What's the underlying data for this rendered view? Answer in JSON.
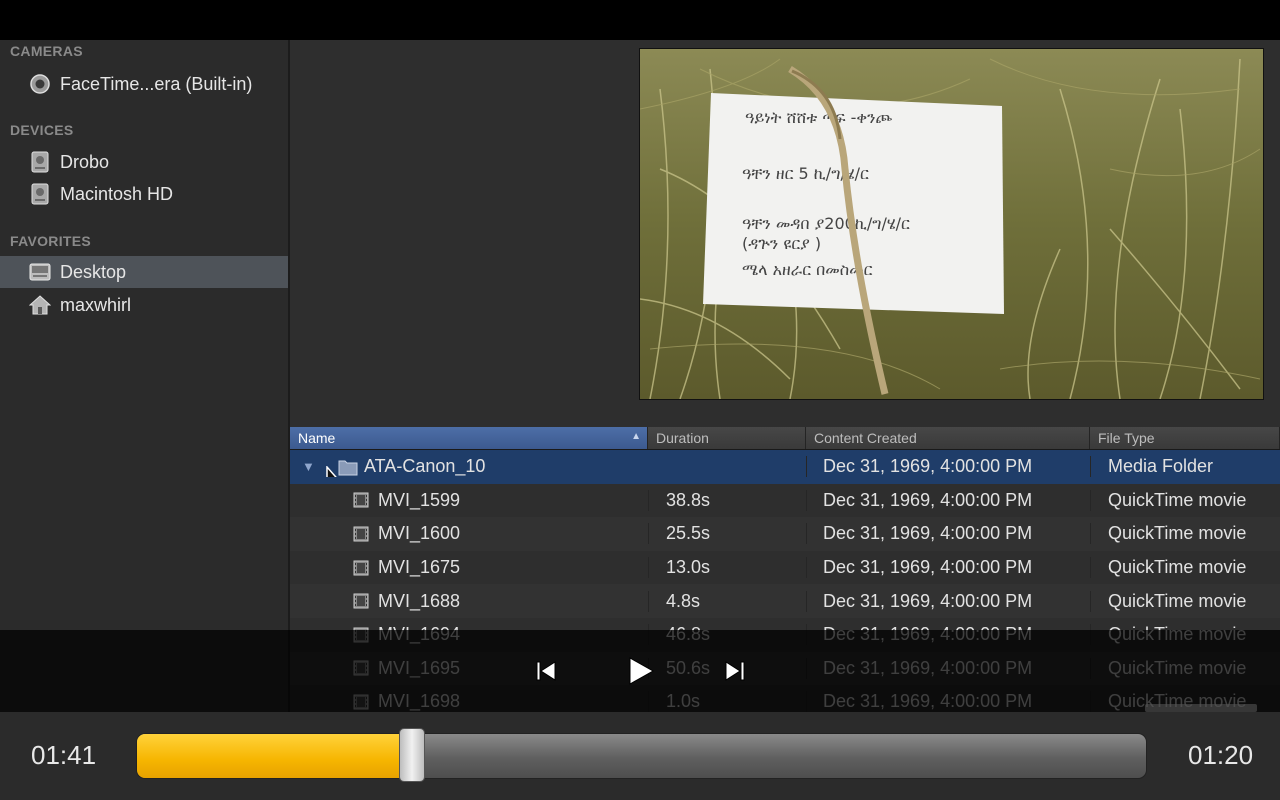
{
  "sidebar": {
    "sections": [
      {
        "header": "CAMERAS",
        "items": [
          {
            "label": "FaceTime...era (Built-in)",
            "icon": "camera-icon"
          }
        ]
      },
      {
        "header": "DEVICES",
        "items": [
          {
            "label": "Drobo",
            "icon": "drive-icon"
          },
          {
            "label": "Macintosh HD",
            "icon": "drive-icon"
          }
        ]
      },
      {
        "header": "FAVORITES",
        "items": [
          {
            "label": "Desktop",
            "icon": "desktop-icon",
            "selected": true
          },
          {
            "label": "maxwhirl",
            "icon": "home-icon"
          }
        ]
      }
    ]
  },
  "preview": {
    "sign_lines": [
      "ዓይነት ሸሸቱ ጣፍ -ቀንጮ",
      "ዓቸን ዘር 5 ኪ/ግ/ሄ/ር",
      "ዓቸን መዳበ ያ200ኪ/ግ/ሄ/ር",
      "(ዳጕን ዩርያ )",
      "ሜላ አዘራር በመስመር"
    ]
  },
  "table": {
    "columns": [
      "Name",
      "Duration",
      "Content Created",
      "File Type"
    ],
    "sort_indicator": "▲",
    "folder": {
      "name": "ATA-Canon_10",
      "created": "Dec 31, 1969, 4:00:00 PM",
      "type": "Media Folder"
    },
    "rows": [
      {
        "name": "MVI_1599",
        "duration": "38.8s",
        "created": "Dec 31, 1969, 4:00:00 PM",
        "type": "QuickTime movie"
      },
      {
        "name": "MVI_1600",
        "duration": "25.5s",
        "created": "Dec 31, 1969, 4:00:00 PM",
        "type": "QuickTime movie"
      },
      {
        "name": "MVI_1675",
        "duration": "13.0s",
        "created": "Dec 31, 1969, 4:00:00 PM",
        "type": "QuickTime movie"
      },
      {
        "name": "MVI_1688",
        "duration": "4.8s",
        "created": "Dec 31, 1969, 4:00:00 PM",
        "type": "QuickTime movie"
      },
      {
        "name": "MVI_1694",
        "duration": "46.8s",
        "created": "Dec 31, 1969, 4:00:00 PM",
        "type": "QuickTime movie"
      },
      {
        "name": "MVI_1695",
        "duration": "50.6s",
        "created": "Dec 31, 1969, 4:00:00 PM",
        "type": "QuickTime movie"
      },
      {
        "name": "MVI_1698",
        "duration": "1.0s",
        "created": "Dec 31, 1969, 4:00:00 PM",
        "type": "QuickTime movie"
      }
    ]
  },
  "player": {
    "elapsed": "01:41",
    "remaining": "01:20",
    "progress_fraction": 0.273,
    "accent_color": "#f6b500"
  }
}
